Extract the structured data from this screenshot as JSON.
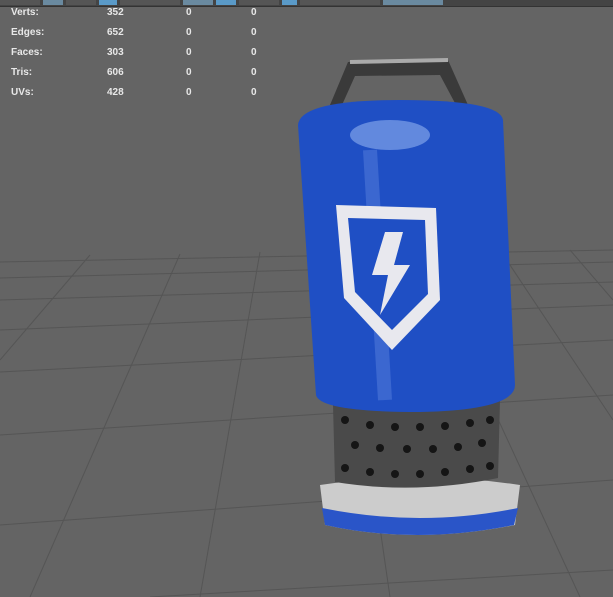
{
  "heads_up_display": {
    "rows": [
      {
        "label": "Verts:",
        "total": "352",
        "selected": "0",
        "uv": "0"
      },
      {
        "label": "Edges:",
        "total": "652",
        "selected": "0",
        "uv": "0"
      },
      {
        "label": "Faces:",
        "total": "303",
        "selected": "0",
        "uv": "0"
      },
      {
        "label": "Tris:",
        "total": "606",
        "selected": "0",
        "uv": "0"
      },
      {
        "label": "UVs:",
        "total": "428",
        "selected": "0",
        "uv": "0"
      }
    ]
  },
  "viewport": {
    "background": "#646464",
    "grid_color": "#505050",
    "model": "battery-canister",
    "model_color": "#1f4fc4",
    "icon": "lightning-shield-icon"
  }
}
